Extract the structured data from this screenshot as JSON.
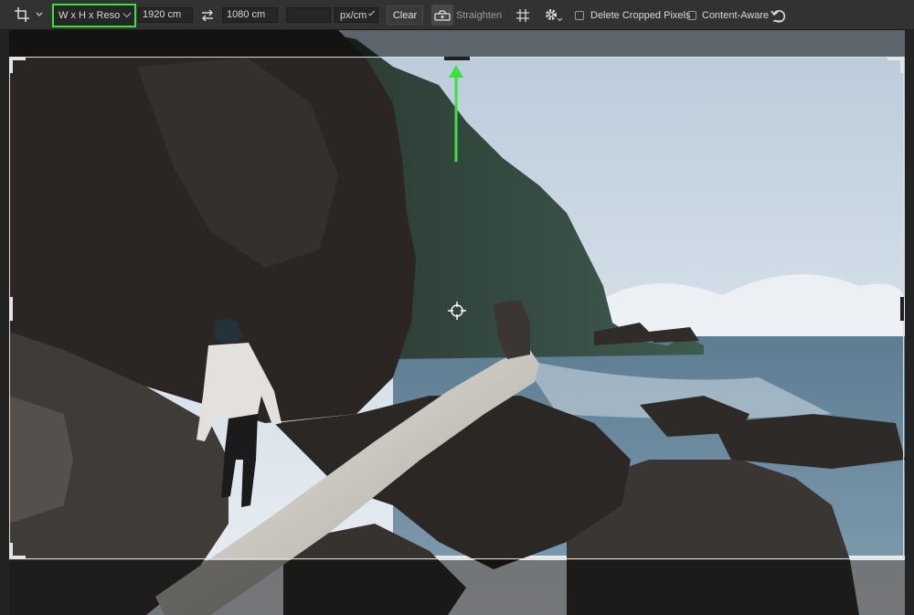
{
  "toolbar": {
    "tool_icon": "crop-icon",
    "ratio_preset": "W x H x Reso...",
    "width_value": "1920 cm",
    "swap_icon": "swap-arrows-icon",
    "height_value": "1080 cm",
    "resolution_value": "",
    "unit": "px/cm",
    "clear_label": "Clear",
    "straighten_icon": "level-icon",
    "straighten_label": "Straighten",
    "overlay_icon": "grid-icon",
    "settings_icon": "gear-icon",
    "delete_cropped_label": "Delete Cropped Pixels",
    "delete_cropped_checked": false,
    "content_aware_label": "Content-Aware",
    "content_aware_checked": false,
    "reset_icon": "undo-icon",
    "highlight_color": "#3ee03e"
  },
  "canvas": {
    "annotation_arrow_color": "#3ee03e",
    "center_marker_icon": "crosshair-icon"
  }
}
